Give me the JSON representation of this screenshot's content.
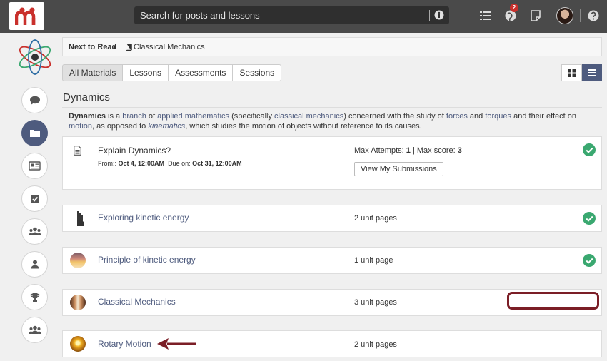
{
  "topbar": {
    "search_placeholder": "Search for posts and lessons",
    "notification_count": "2"
  },
  "next_to_read": {
    "label": "Next to Read",
    "title": "Classical Mechanics"
  },
  "tabs": [
    {
      "label": "All Materials",
      "active": true
    },
    {
      "label": "Lessons",
      "active": false
    },
    {
      "label": "Assessments",
      "active": false
    },
    {
      "label": "Sessions",
      "active": false
    }
  ],
  "section": {
    "heading": "Dynamics",
    "description": {
      "term": "Dynamics",
      "p1": " is a ",
      "l1": "branch",
      "p2": " of ",
      "l2": "applied mathematics",
      "p3": " (specifically ",
      "l3": "classical mechanics",
      "p4": ") concerned with the study of ",
      "l4": "forces",
      "p5": " and ",
      "l5": "torques",
      "p6": " and their effect on ",
      "l6": "motion",
      "p7": ", as opposed to ",
      "l7": "kinematics",
      "p8": ", which studies the motion of objects without reference to its causes."
    }
  },
  "assessment": {
    "title": "Explain Dynamics?",
    "from_label": "From::",
    "from_value": "Oct 4, 12:00AM",
    "due_label": "Due on:",
    "due_value": "Oct 31, 12:00AM",
    "max_attempts_label": "Max Attempts:",
    "max_attempts": "1",
    "divider": "|",
    "max_score_label": "Max score:",
    "max_score": "3",
    "button": "View My Submissions",
    "completed": true
  },
  "lessons": [
    {
      "title": "Exploring kinetic energy",
      "pages": "2 unit pages",
      "completed": true
    },
    {
      "title": "Principle of kinetic energy",
      "pages": "1 unit page",
      "completed": true
    },
    {
      "title": "Classical Mechanics",
      "pages": "3 unit pages",
      "completed": false
    },
    {
      "title": "Rotary Motion",
      "pages": "2 unit pages",
      "completed": false
    }
  ],
  "colors": {
    "accent": "#4e5b7e",
    "success": "#3aa870",
    "highlight": "#7b1e26",
    "topbar": "#4a4a4a"
  }
}
